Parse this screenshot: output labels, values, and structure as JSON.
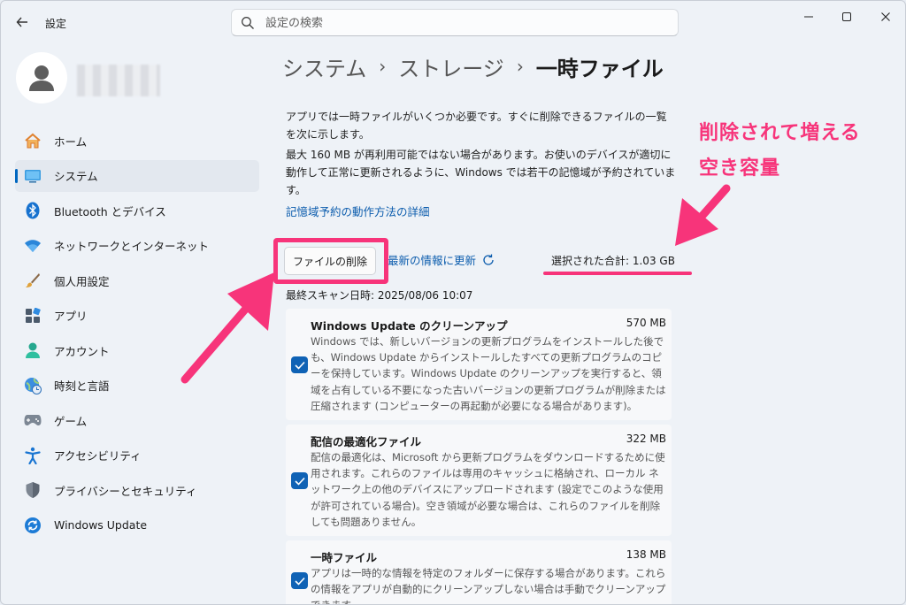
{
  "window": {
    "app_title": "設定",
    "search_placeholder": "設定の検索",
    "controls": {
      "minimize": "—",
      "maximize": "☐",
      "close": "✕"
    }
  },
  "sidebar": {
    "items": [
      {
        "label": "ホーム",
        "icon": "home-icon"
      },
      {
        "label": "システム",
        "icon": "system-icon",
        "active": true
      },
      {
        "label": "Bluetooth とデバイス",
        "icon": "bluetooth-icon"
      },
      {
        "label": "ネットワークとインターネット",
        "icon": "wifi-icon"
      },
      {
        "label": "個人用設定",
        "icon": "brush-icon"
      },
      {
        "label": "アプリ",
        "icon": "apps-icon"
      },
      {
        "label": "アカウント",
        "icon": "account-icon"
      },
      {
        "label": "時刻と言語",
        "icon": "globe-clock-icon"
      },
      {
        "label": "ゲーム",
        "icon": "gamepad-icon"
      },
      {
        "label": "アクセシビリティ",
        "icon": "accessibility-icon"
      },
      {
        "label": "プライバシーとセキュリティ",
        "icon": "shield-icon"
      },
      {
        "label": "Windows Update",
        "icon": "update-icon"
      }
    ]
  },
  "breadcrumb": {
    "part1": "システム",
    "part2": "ストレージ",
    "current": "一時ファイル",
    "separator": "›"
  },
  "main": {
    "desc1": "アプリでは一時ファイルがいくつか必要です。すぐに削除できるファイルの一覧を次に示します。",
    "desc2": "最大 160 MB が再利用可能ではない場合があります。お使いのデバイスが適切に動作して正常に更新されるように、Windows では若干の記憶域が予約されています。",
    "reserve_link": "記憶域予約の動作方法の詳細",
    "delete_button": "ファイルの削除",
    "refresh_link": "最新の情報に更新",
    "selected_total": "選択された合計: 1.03 GB",
    "last_scan": "最終スキャン日時: 2025/08/06 10:07"
  },
  "items": [
    {
      "title": "Windows Update のクリーンアップ",
      "size": "570 MB",
      "checked": true,
      "desc": "Windows では、新しいバージョンの更新プログラムをインストールした後でも、Windows Update からインストールしたすべての更新プログラムのコピーを保持しています。Windows Update のクリーンアップを実行すると、領域を占有している不要になった古いバージョンの更新プログラムが削除または圧縮されます (コンピューターの再起動が必要になる場合があります)。"
    },
    {
      "title": "配信の最適化ファイル",
      "size": "322 MB",
      "checked": true,
      "desc": "配信の最適化は、Microsoft から更新プログラムをダウンロードするために使用されます。これらのファイルは専用のキャッシュに格納され、ローカル ネットワーク上の他のデバイスにアップロードされます (設定でこのような使用が許可されている場合)。空き領域が必要な場合は、これらのファイルを削除しても問題ありません。"
    },
    {
      "title": "一時ファイル",
      "size": "138 MB",
      "checked": true,
      "desc": "アプリは一時的な情報を特定のフォルダーに保存する場合があります。これらの情報をアプリが自動的にクリーンアップしない場合は手動でクリーンアップできます。"
    }
  ],
  "annotation": {
    "line1": "削除されて増える",
    "line2": "空き容量",
    "color": "#f7347a"
  },
  "colors": {
    "accent": "#0067c0",
    "checkbox": "#0f62b5",
    "link": "#0b5cad"
  }
}
